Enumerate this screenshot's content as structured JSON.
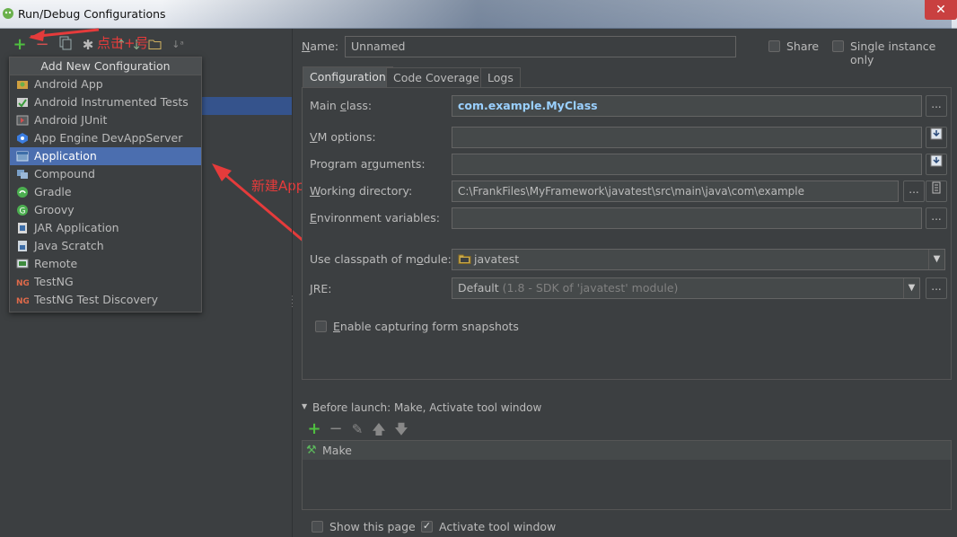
{
  "window": {
    "title": "Run/Debug Configurations",
    "close_glyph": "✕"
  },
  "left_toolbar": {
    "annotation": "点击+号"
  },
  "popup": {
    "title": "Add New Configuration",
    "items": [
      {
        "label": "Android App",
        "icon": "android-app-icon"
      },
      {
        "label": "Android Instrumented Tests",
        "icon": "android-tests-icon"
      },
      {
        "label": "Android JUnit",
        "icon": "android-junit-icon"
      },
      {
        "label": "App Engine DevAppServer",
        "icon": "app-engine-icon"
      },
      {
        "label": "Application",
        "icon": "application-icon",
        "selected": true
      },
      {
        "label": "Compound",
        "icon": "compound-icon"
      },
      {
        "label": "Gradle",
        "icon": "gradle-icon"
      },
      {
        "label": "Groovy",
        "icon": "groovy-icon"
      },
      {
        "label": "JAR Application",
        "icon": "jar-application-icon"
      },
      {
        "label": "Java Scratch",
        "icon": "java-scratch-icon"
      },
      {
        "label": "Remote",
        "icon": "remote-icon"
      },
      {
        "label": "TestNG",
        "icon": "testng-icon"
      },
      {
        "label": "TestNG Test Discovery",
        "icon": "testng-discovery-icon"
      }
    ]
  },
  "annotation_new_app": "新建Application",
  "header": {
    "name_label": "Name:",
    "name_value": "Unnamed",
    "share_label": "Share",
    "single_instance_label": "Single instance only"
  },
  "tabs": [
    "Configuration",
    "Code Coverage",
    "Logs"
  ],
  "config": {
    "main_class_label": "Main class:",
    "main_class_value": "com.example.MyClass",
    "vm_options_label": "VM options:",
    "program_args_label": "Program arguments:",
    "working_dir_label": "Working directory:",
    "working_dir_value": "C:\\FrankFiles\\MyFramework\\javatest\\src\\main\\java\\com\\example",
    "env_vars_label": "Environment variables:",
    "classpath_label": "Use classpath of module:",
    "classpath_value": "javatest",
    "jre_label": "JRE:",
    "jre_value": "Default",
    "jre_detail": "(1.8 - SDK of 'javatest' module)",
    "form_snapshots_label": "Enable capturing form snapshots",
    "ellipsis": "..."
  },
  "before_launch": {
    "header": "Before launch: Make, Activate tool window",
    "items": [
      {
        "label": "Make",
        "icon": "hammer-icon"
      }
    ]
  },
  "footer": {
    "show_page_label": "Show this page",
    "activate_tool_label": "Activate tool window",
    "activate_checked": true
  },
  "colors": {
    "accent": "#4b6eaf",
    "annotation": "#e53b3b",
    "background": "#3c3f41"
  }
}
